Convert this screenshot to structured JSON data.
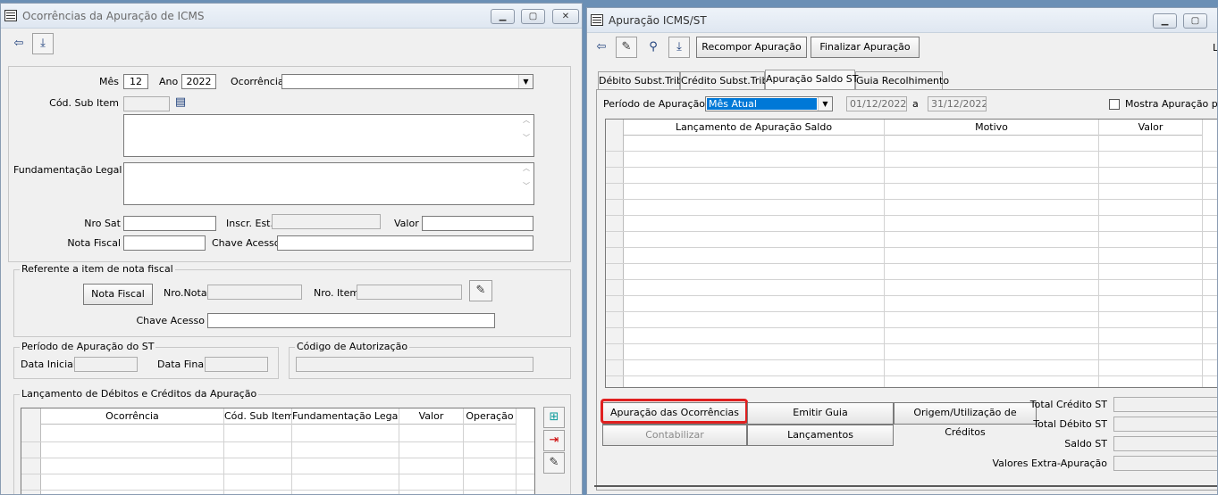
{
  "left_window": {
    "title": "Ocorrências da Apuração de ICMS",
    "form": {
      "mes_label": "Mês",
      "mes_value": "12",
      "ano_label": "Ano",
      "ano_value": "2022",
      "ocorrencia_label": "Ocorrência",
      "ocorrencia_value": "",
      "cod_sub_item_label": "Cód. Sub Item",
      "fundamentacao_label": "Fundamentação Legal",
      "nro_sat_label": "Nro Sat",
      "inscr_est_label": "Inscr. Est.",
      "valor_label": "Valor",
      "nota_fiscal_label": "Nota Fiscal",
      "chave_acesso_label": "Chave Acesso"
    },
    "ref_group": {
      "title": "Referente a item de nota fiscal",
      "nota_fiscal_button": "Nota Fiscal",
      "nro_nota_label": "Nro.Nota",
      "nro_item_label": "Nro. Item",
      "chave_acesso_label": "Chave Acesso"
    },
    "periodo_group": {
      "title": "Período de Apuração do ST",
      "data_inicial_label": "Data Inicial",
      "data_final_label": "Data Final"
    },
    "codigo_group": {
      "title": "Código de Autorização"
    },
    "lanc_group": {
      "title": "Lançamento de Débitos e Créditos da Apuração",
      "columns": [
        "Ocorrência",
        "Cód. Sub Item",
        "Fundamentação Legal",
        "Valor",
        "Operação"
      ]
    }
  },
  "right_window": {
    "title": "Apuração ICMS/ST",
    "toolbar": {
      "recompor_label": "Recompor Apuração",
      "finalizar_label": "Finalizar Apuração"
    },
    "tabs": [
      "Débito Subst.Trib.",
      "Crédito Subst.Trib.",
      "Apuração Saldo ST",
      "Guia Recolhimento"
    ],
    "periodo_label": "Período de Apuração",
    "periodo_select": "Mês Atual",
    "date_from": "01/12/2022",
    "date_sep": "a",
    "date_to": "31/12/2022",
    "mostra_label": "Mostra Apuração por U",
    "grid_columns": [
      "Lançamento de Apuração Saldo",
      "Motivo",
      "Valor"
    ],
    "buttons": {
      "apuracao_ocorrencias": "Apuração das Ocorrências",
      "emitir_guia": "Emitir Guia",
      "origem": "Origem/Utilização de Créditos",
      "contabilizar": "Contabilizar",
      "lancamentos": "Lançamentos"
    },
    "totals": {
      "total_credito": "Total Crédito ST",
      "total_debito": "Total Débito ST",
      "saldo": "Saldo ST",
      "valores_extra": "Valores Extra-Apuração"
    },
    "highlight_color": "#e02020"
  }
}
